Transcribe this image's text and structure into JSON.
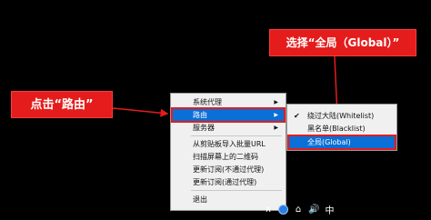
{
  "callouts": {
    "route": "点击“路由”",
    "global": "选择“全局（Global）”"
  },
  "main_menu": {
    "items": [
      {
        "label": "系统代理",
        "has_submenu": true
      },
      {
        "label": "路由",
        "has_submenu": true
      },
      {
        "label": "服务器",
        "has_submenu": true
      },
      {
        "label": "从剪贴板导入批量URL",
        "has_submenu": false
      },
      {
        "label": "扫描屏幕上的二维码",
        "has_submenu": false
      },
      {
        "label": "更新订阅(不通过代理)",
        "has_submenu": false
      },
      {
        "label": "更新订阅(通过代理)",
        "has_submenu": false
      },
      {
        "label": "退出",
        "has_submenu": false
      }
    ],
    "submenu_arrow": "▶"
  },
  "route_submenu": {
    "items": [
      {
        "label": "绕过大陆(Whitelist)",
        "checked": true
      },
      {
        "label": "黑名单(Blacklist)",
        "checked": false
      },
      {
        "label": "全局(Global)",
        "checked": false
      }
    ],
    "check_glyph": "✔"
  },
  "tray": {
    "chevron": "∧",
    "volume": "🔊",
    "network": "⌂",
    "language": "中"
  },
  "colors": {
    "callout_red": "#e51c1c",
    "selection_blue": "#0a6fd6",
    "menu_bg": "#f0f0f0"
  }
}
